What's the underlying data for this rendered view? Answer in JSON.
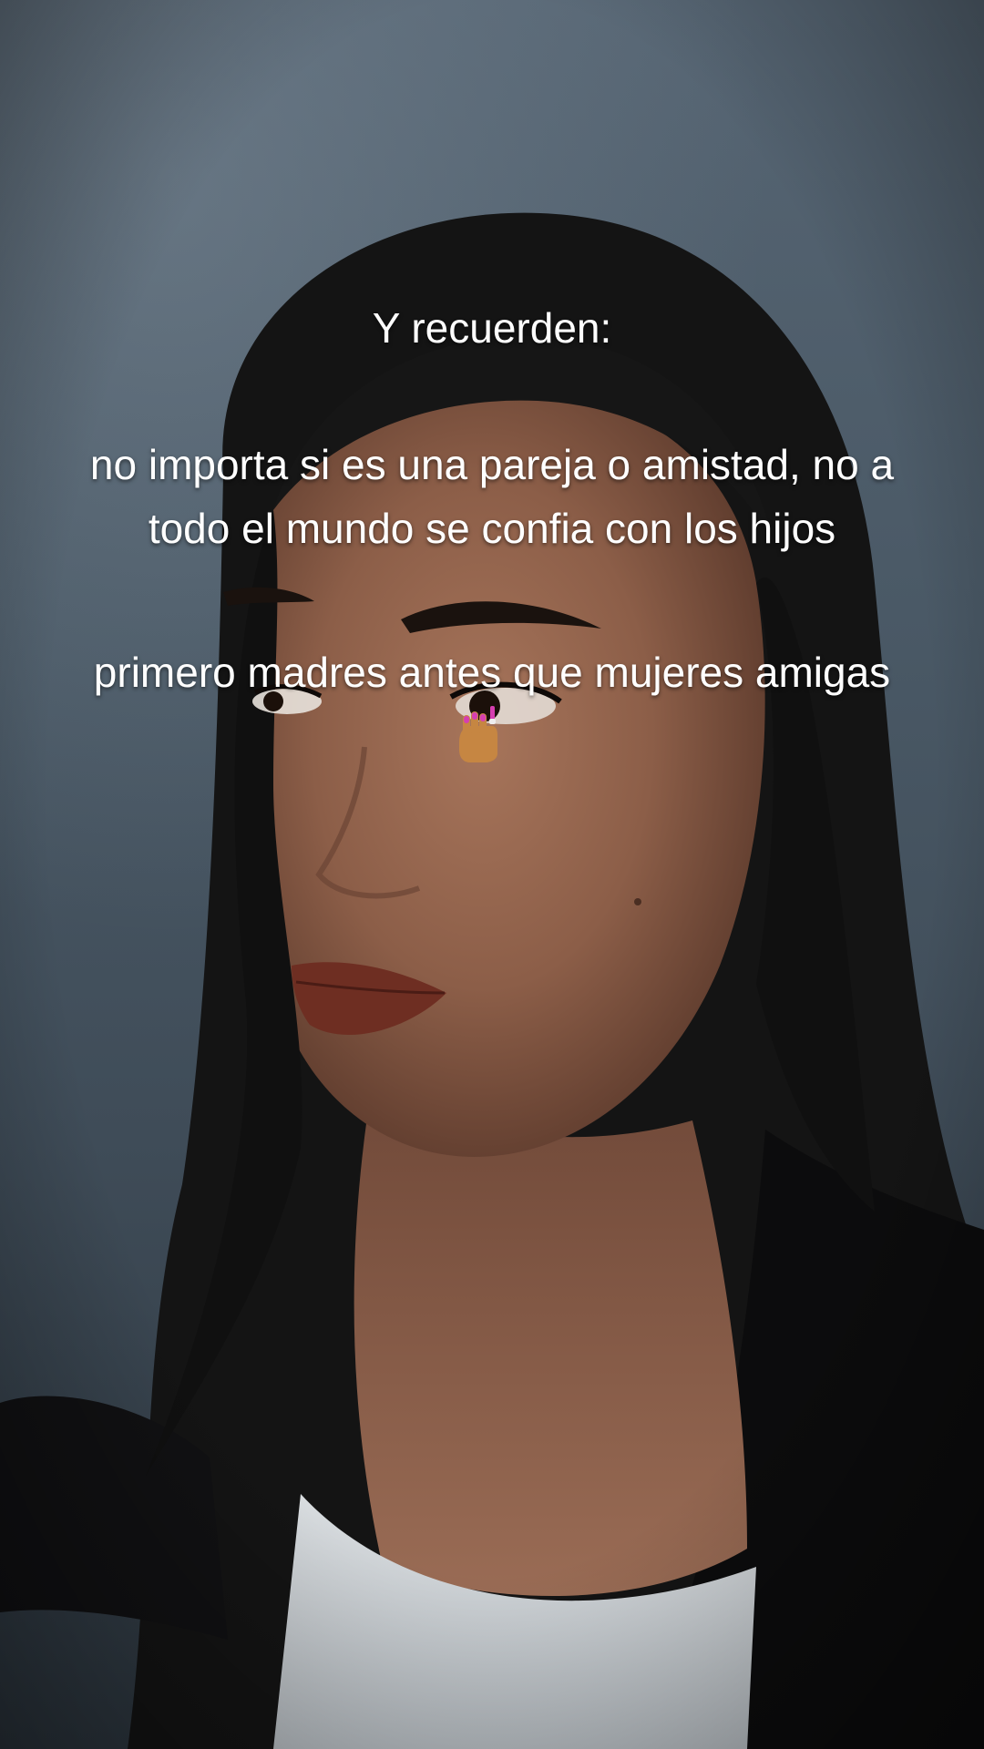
{
  "caption": {
    "line1": "Y recuerden:",
    "line2a": "no importa si es una pareja o amistad, no a",
    "line2b": "todo el mundo se confia con los hijos",
    "line3": "primero madres antes que mujeres amigas"
  },
  "emoji": "nail-polish-emoji",
  "colors": {
    "background": "#4a5966",
    "hair": "#141414",
    "skin": "#9a6a52",
    "lips": "#6e2e22",
    "shirt": "#e9ecee",
    "jacket": "#0c0c0d",
    "text": "#ffffff"
  }
}
